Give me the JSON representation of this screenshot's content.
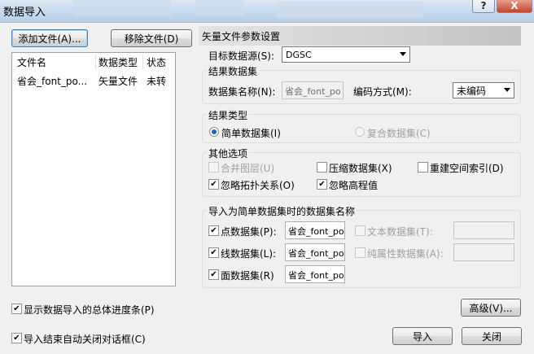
{
  "window": {
    "title": "数据导入",
    "help_glyph": "?",
    "close_glyph": "X"
  },
  "file_panel": {
    "add_file": "添加文件(A)...",
    "remove_file": "移除文件(D)",
    "columns": [
      "文件名",
      "数据类型",
      "状态"
    ],
    "rows": [
      {
        "name": "省会_font_po...",
        "type": "矢量文件",
        "status": "未转"
      }
    ]
  },
  "settings": {
    "header": "矢量文件参数设置",
    "target_datasource_label": "目标数据源(S):",
    "target_datasource_value": "DGSC",
    "result_dataset_group": "结果数据集",
    "dataset_name_label": "数据集名称(N):",
    "dataset_name_value": "省会_font_po",
    "encoding_label": "编码方式(M):",
    "encoding_value": "未编码",
    "result_type_group": "结果类型",
    "simple_dataset": "简单数据集(I)",
    "complex_dataset": "复合数据集(C)",
    "other_options_group": "其他选项",
    "merge_layers": "合并图层(U)",
    "compress_dataset": "压缩数据集(X)",
    "rebuild_spatial_index": "重建空间索引(D)",
    "ignore_topology": "忽略拓扑关系(O)",
    "ignore_elevation": "忽略高程值",
    "names_group": "导入为简单数据集时的数据集名称",
    "point_dataset": "点数据集(P):",
    "point_dataset_value": "省会_font_po",
    "line_dataset": "线数据集(L):",
    "line_dataset_value": "省会_font_po",
    "region_dataset": "面数据集(R)",
    "region_dataset_value": "省会_font_po",
    "text_dataset": "文本数据集(T):",
    "text_dataset_value": "",
    "attribute_dataset": "纯属性数据集(A):",
    "attribute_dataset_value": ""
  },
  "footer": {
    "show_progress": "显示数据导入的总体进度条(P)",
    "advanced": "高级(V)...",
    "auto_close": "导入结束自动关闭对话框(C)",
    "import": "导入",
    "close": "关闭"
  },
  "check_glyph": "✔"
}
